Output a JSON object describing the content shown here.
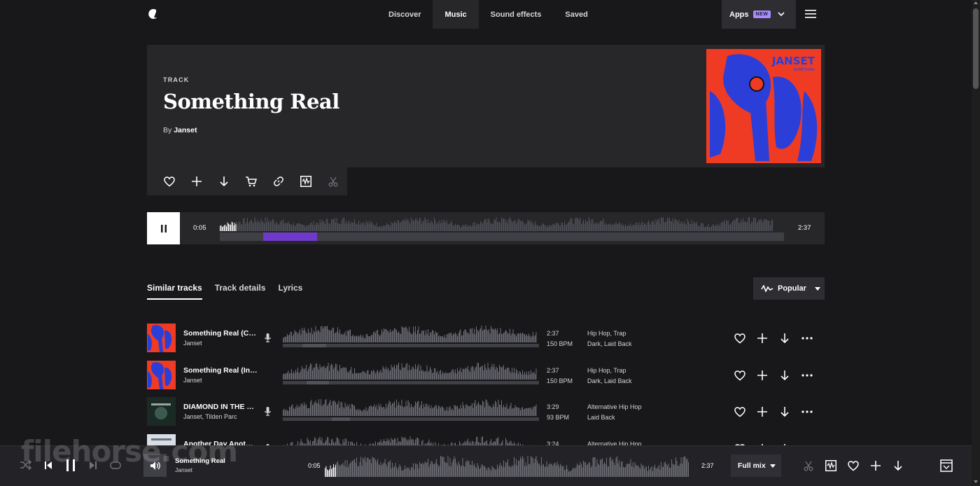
{
  "nav": {
    "tabs": [
      {
        "label": "Discover",
        "active": false
      },
      {
        "label": "Music",
        "active": true
      },
      {
        "label": "Sound effects",
        "active": false
      },
      {
        "label": "Saved",
        "active": false
      }
    ],
    "apps_label": "Apps",
    "new_badge": "NEW"
  },
  "track": {
    "type_label": "TRACK",
    "title": "Something Real",
    "by_prefix": "By",
    "artist": "Janset",
    "cover_text_top": "JANSET",
    "cover_text_sub": "SOMETHING"
  },
  "track_actions": [
    "heart-icon",
    "add-icon",
    "download-icon",
    "cart-icon",
    "link-icon",
    "waveform-icon",
    "scissors-icon"
  ],
  "player": {
    "current_time": "0:05",
    "total_time": "2:37",
    "progress_fraction": 0.03,
    "state": "playing"
  },
  "content_tabs": [
    {
      "label": "Similar tracks",
      "active": true
    },
    {
      "label": "Track details",
      "active": false
    },
    {
      "label": "Lyrics",
      "active": false
    }
  ],
  "sort": {
    "label": "Popular"
  },
  "similar_tracks": [
    {
      "name": "Something Real (C…",
      "artist": "Janset",
      "vocal": true,
      "duration": "2:37",
      "bpm": "150 BPM",
      "genres": [
        "Hip Hop",
        "Trap"
      ],
      "moods": [
        "Dark",
        "Laid Back"
      ],
      "cover": "red-blue"
    },
    {
      "name": "Something Real (Instr…",
      "artist": "Janset",
      "vocal": false,
      "duration": "2:37",
      "bpm": "150 BPM",
      "genres": [
        "Hip Hop",
        "Trap"
      ],
      "moods": [
        "Dark",
        "Laid Back"
      ],
      "cover": "red-blue"
    },
    {
      "name": "DIAMOND IN THE …",
      "artist": "Janset, Tilden Parc",
      "vocal": true,
      "duration": "3:29",
      "bpm": "93 BPM",
      "genres": [
        "Alternative Hip Hop"
      ],
      "moods": [
        "Laid Back"
      ],
      "cover": "dark-green"
    },
    {
      "name": "Another Day Anot…",
      "artist": "",
      "vocal": true,
      "duration": "3:24",
      "bpm": "",
      "genres": [
        "Alternative Hip Hop"
      ],
      "moods": [],
      "cover": "light"
    }
  ],
  "bottom_player": {
    "title": "Something Real",
    "artist": "Janset",
    "current_time": "0:05",
    "total_time": "2:37",
    "mix_label": "Full mix"
  },
  "watermark": "filehorse.com",
  "colors": {
    "background": "#18181b",
    "panel": "#27272a",
    "accent": "#7c3aed",
    "badge": "#a78bfa"
  }
}
